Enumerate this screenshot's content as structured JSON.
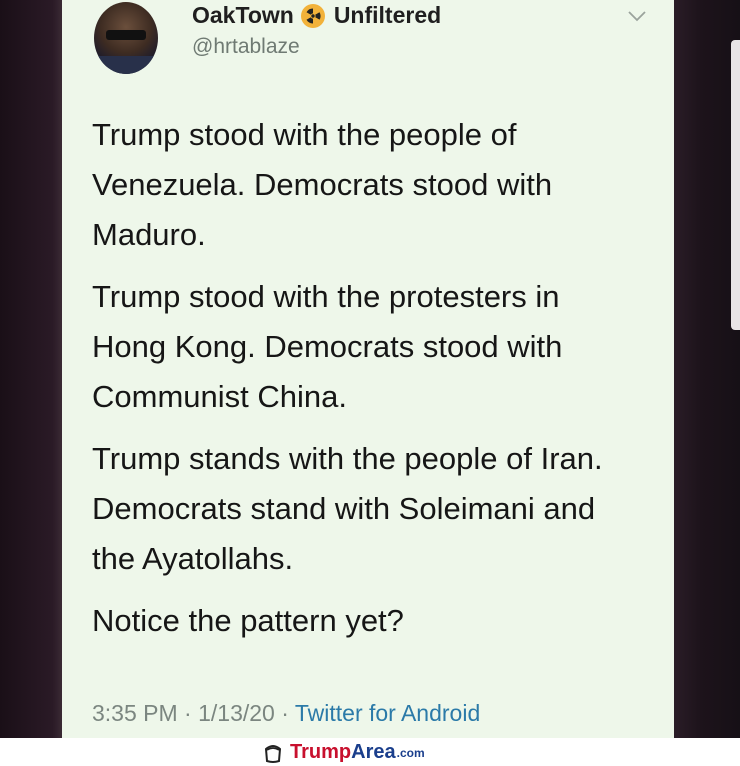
{
  "tweet": {
    "display_name_part1": "OakTown",
    "display_name_emoji": "radioactive-icon",
    "display_name_part2": "Unfiltered",
    "handle": "@hrtablaze",
    "paragraphs": [
      [
        "Trump stood with the people of",
        "Venezuela.  Democrats stood with",
        "Maduro."
      ],
      [
        "Trump stood with the protesters in",
        "Hong Kong. Democrats stood with",
        "Communist China."
      ],
      [
        "Trump stands with the people of Iran.",
        "Democrats stand with Soleimani and",
        "the Ayatollahs."
      ],
      [
        "Notice the pattern yet?"
      ]
    ],
    "timestamp": "3:35 PM · 1/13/20 ·",
    "source": "Twitter for Android"
  },
  "watermark": {
    "brand_part1": "Trump",
    "brand_part2": "Area",
    "brand_tld": ".com"
  },
  "colors": {
    "card_background": "#eef7ea",
    "link_blue": "#2b7aa8",
    "emoji_yellow": "#f2b23a",
    "brand_red": "#c8102e",
    "brand_blue": "#1a3e8c"
  }
}
